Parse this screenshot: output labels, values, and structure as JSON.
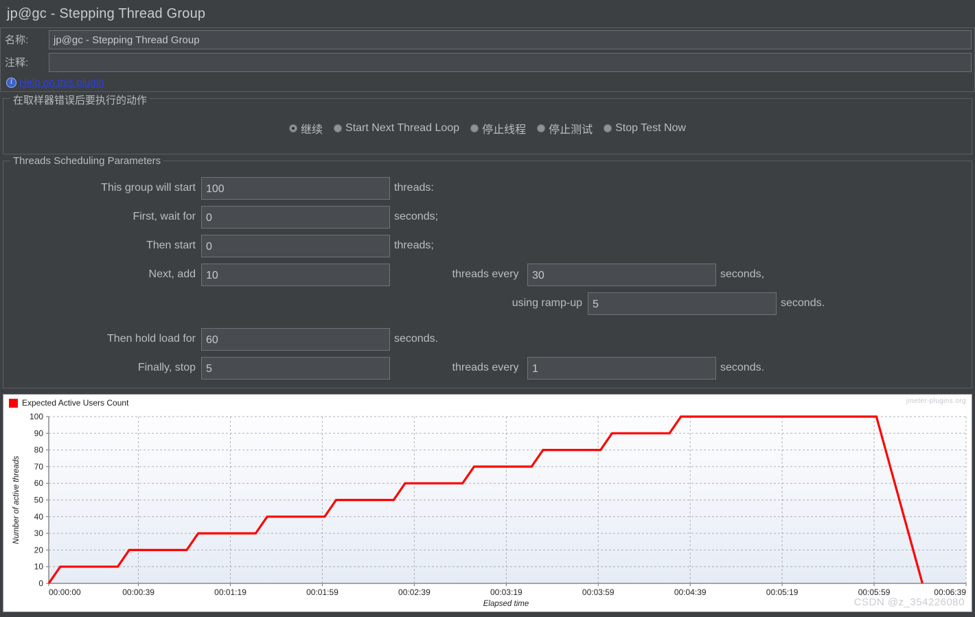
{
  "window": {
    "title": "jp@gc - Stepping Thread Group"
  },
  "meta": {
    "name_label": "名称:",
    "name_value": "jp@gc - Stepping Thread Group",
    "comment_label": "注释:",
    "comment_value": "",
    "help_link": "Help on this plugin",
    "info_icon": "info-icon"
  },
  "error_action": {
    "group_title": "在取样器错误后要执行的动作",
    "options": [
      {
        "label": "继续",
        "selected": true
      },
      {
        "label": "Start Next Thread Loop",
        "selected": false
      },
      {
        "label": "停止线程",
        "selected": false
      },
      {
        "label": "停止测试",
        "selected": false
      },
      {
        "label": "Stop Test Now",
        "selected": false
      }
    ]
  },
  "scheduling": {
    "group_title": "Threads Scheduling Parameters",
    "rows": {
      "total_threads": {
        "label": "This group will start",
        "value": "100",
        "unit": "threads:"
      },
      "first_wait": {
        "label": "First, wait for",
        "value": "0",
        "unit": "seconds;"
      },
      "then_start": {
        "label": "Then start",
        "value": "0",
        "unit": "threads;"
      },
      "next_add": {
        "label": "Next, add",
        "value": "10",
        "mid_label": "threads every",
        "value2": "30",
        "unit": "seconds,"
      },
      "ramp_up": {
        "label": "using ramp-up",
        "value": "5",
        "unit": "seconds."
      },
      "hold_load": {
        "label": "Then hold load for",
        "value": "60",
        "unit": "seconds."
      },
      "finally_stop": {
        "label": "Finally, stop",
        "value": "5",
        "mid_label": "threads every",
        "value2": "1",
        "unit": "seconds."
      }
    }
  },
  "chart_data": {
    "type": "line",
    "title": "",
    "legend": [
      "Expected Active Users Count"
    ],
    "legend_position": "top-left",
    "series_color": "#ff0000",
    "xlabel": "Elapsed time",
    "ylabel": "Number of active threads",
    "ylim": [
      0,
      100
    ],
    "yticks": [
      0,
      10,
      20,
      30,
      40,
      50,
      60,
      70,
      80,
      90,
      100
    ],
    "xlim_seconds": [
      0,
      399
    ],
    "xticks": [
      "00:00:00",
      "00:00:39",
      "00:01:19",
      "00:01:59",
      "00:02:39",
      "00:03:19",
      "00:03:59",
      "00:04:39",
      "00:05:19",
      "00:05:59",
      "00:06:39"
    ],
    "xtick_seconds": [
      0,
      39,
      79,
      119,
      159,
      199,
      239,
      279,
      319,
      359,
      399
    ],
    "grid": true,
    "watermark": "jmeter-plugins.org",
    "footer_watermark": "CSDN @z_354226080",
    "points_seconds_threads": [
      [
        0,
        0
      ],
      [
        5,
        10
      ],
      [
        30,
        10
      ],
      [
        35,
        20
      ],
      [
        60,
        20
      ],
      [
        65,
        30
      ],
      [
        90,
        30
      ],
      [
        95,
        40
      ],
      [
        120,
        40
      ],
      [
        125,
        50
      ],
      [
        150,
        50
      ],
      [
        155,
        60
      ],
      [
        180,
        60
      ],
      [
        185,
        70
      ],
      [
        210,
        70
      ],
      [
        215,
        80
      ],
      [
        240,
        80
      ],
      [
        245,
        90
      ],
      [
        270,
        90
      ],
      [
        275,
        100
      ],
      [
        300,
        100
      ],
      [
        360,
        100
      ],
      [
        361,
        95
      ],
      [
        362,
        90
      ],
      [
        363,
        85
      ],
      [
        364,
        80
      ],
      [
        365,
        75
      ],
      [
        366,
        70
      ],
      [
        367,
        65
      ],
      [
        368,
        60
      ],
      [
        369,
        55
      ],
      [
        370,
        50
      ],
      [
        371,
        45
      ],
      [
        372,
        40
      ],
      [
        373,
        35
      ],
      [
        374,
        30
      ],
      [
        375,
        25
      ],
      [
        376,
        20
      ],
      [
        377,
        15
      ],
      [
        378,
        10
      ],
      [
        379,
        5
      ],
      [
        380,
        0
      ]
    ]
  }
}
